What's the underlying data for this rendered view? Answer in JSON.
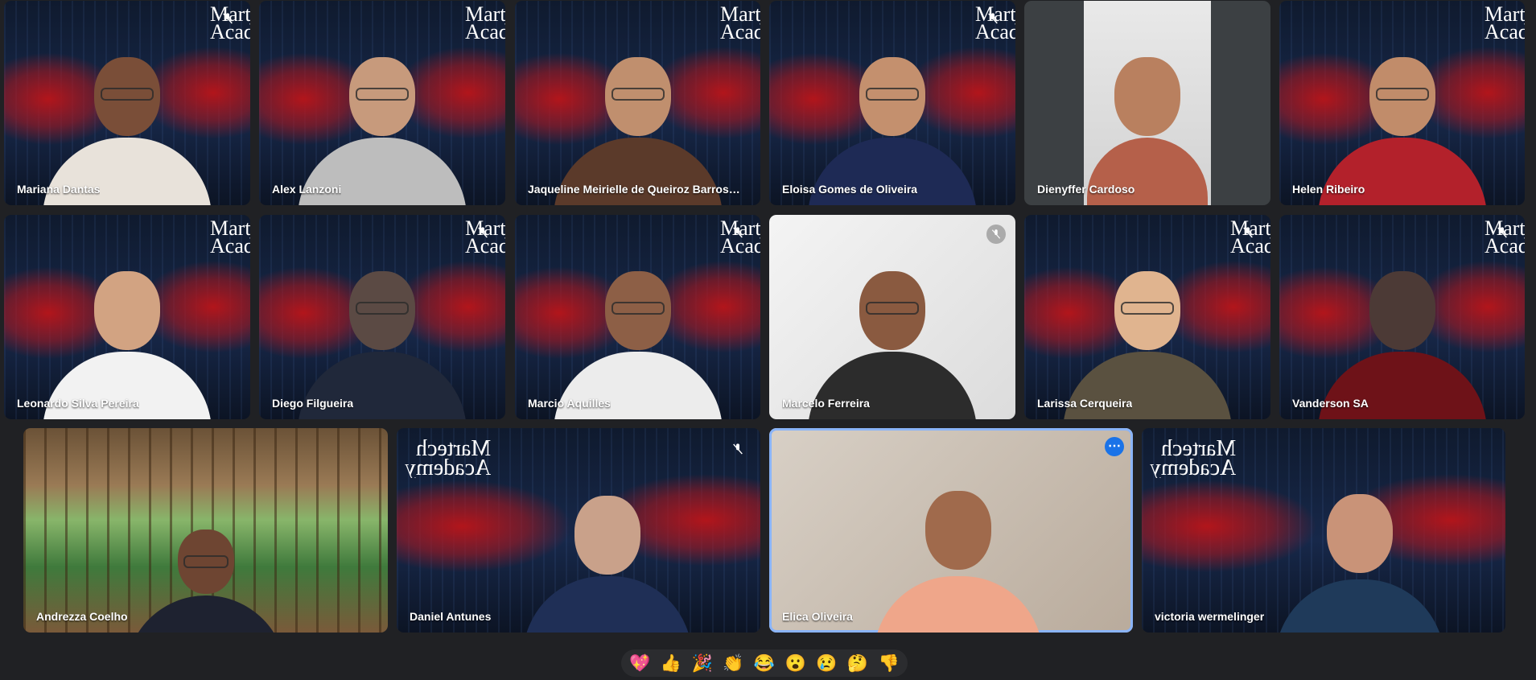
{
  "brand": {
    "line1": "Martech",
    "line2": "Academy"
  },
  "participants": [
    {
      "name": "Mariana Dantas"
    },
    {
      "name": "Alex Lanzoni"
    },
    {
      "name": "Jaqueline Meirielle de Queiroz Barros S..."
    },
    {
      "name": "Eloisa Gomes de Oliveira"
    },
    {
      "name": "Dienyffer Cardoso"
    },
    {
      "name": "Helen Ribeiro"
    },
    {
      "name": "Leonardo Silva Pereira"
    },
    {
      "name": "Diego Filgueira"
    },
    {
      "name": "Marcio Aquilles"
    },
    {
      "name": "Marcelo Ferreira"
    },
    {
      "name": "Larissa Cerqueira"
    },
    {
      "name": "Vanderson SA"
    },
    {
      "name": "Andrezza Coelho"
    },
    {
      "name": "Daniel Antunes"
    },
    {
      "name": "Elica Oliveira"
    },
    {
      "name": "victoria wermelinger"
    }
  ],
  "reactions": [
    "💖",
    "👍",
    "🎉",
    "👏",
    "😂",
    "😮",
    "😢",
    "🤔",
    "👎"
  ],
  "colors": {
    "accent": "#1a73e8",
    "active_border": "#8ab4f8",
    "background": "#202124"
  },
  "icons": {
    "muted": "mic-off-icon",
    "more": "more-options-icon"
  }
}
